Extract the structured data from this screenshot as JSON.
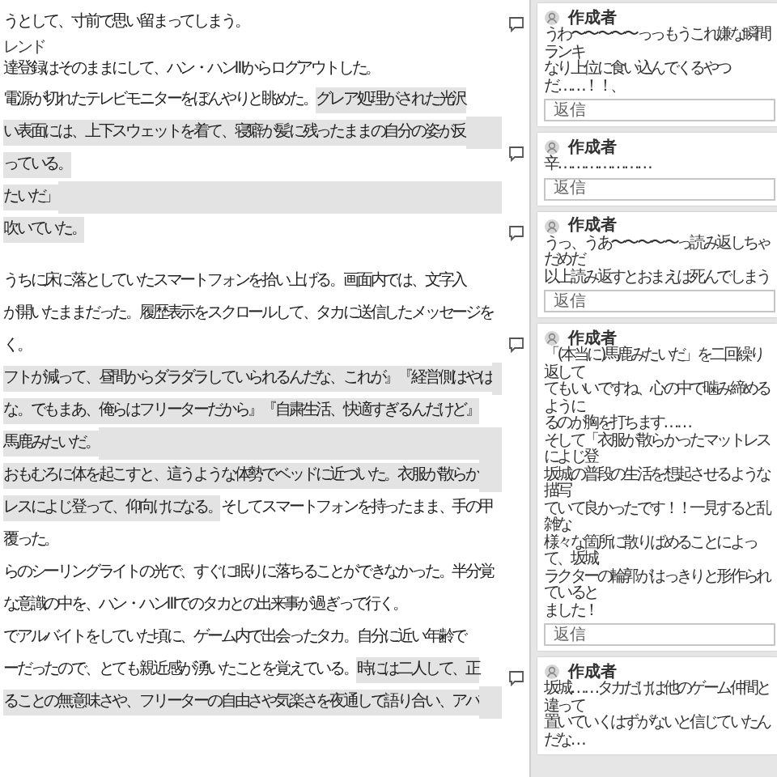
{
  "document": {
    "lines": [
      {
        "kind": "text",
        "highlight_to_end": false,
        "segments": [
          {
            "text": "うとして、寸前で思い留まってしまう。",
            "highlighted": false
          }
        ]
      },
      {
        "kind": "text",
        "highlight_to_end": false,
        "ruby": "レンド",
        "segments": [
          {
            "text": "達登録はそのままにして、ハン・ハンⅢからログアウトした。",
            "highlighted": false
          }
        ]
      },
      {
        "kind": "text",
        "highlight_to_end": false,
        "segments": [
          {
            "text": "電源が切れたテレビモニターをぼんやりと眺めた。",
            "highlighted": false
          },
          {
            "text": "グレア処理がされた光沢",
            "highlighted": true
          }
        ]
      },
      {
        "kind": "text",
        "highlight_to_end": true,
        "segments": [
          {
            "text": "い表面には、上下スウェットを着て、寝癖が髪に残ったままの自分の姿が反",
            "highlighted": true
          }
        ]
      },
      {
        "kind": "text",
        "highlight_to_end": false,
        "segments": [
          {
            "text": "っている。",
            "highlighted": true
          }
        ]
      },
      {
        "kind": "text",
        "highlight_to_end": true,
        "segments": [
          {
            "text": "たいだ」",
            "highlighted": true
          }
        ]
      },
      {
        "kind": "text",
        "highlight_to_end": false,
        "segments": [
          {
            "text": "吹いていた。",
            "highlighted": true
          }
        ]
      },
      {
        "kind": "blank"
      },
      {
        "kind": "text",
        "highlight_to_end": false,
        "segments": [
          {
            "text": "うちに床に落としていたスマートフォンを拾い上げる。画面内では、文字入",
            "highlighted": false
          }
        ]
      },
      {
        "kind": "text",
        "highlight_to_end": false,
        "segments": [
          {
            "text": "が開いたままだった。履歴表示をスクロールして、タカに送信したメッセージを",
            "highlighted": false
          }
        ]
      },
      {
        "kind": "text",
        "highlight_to_end": false,
        "segments": [
          {
            "text": "く。",
            "highlighted": false
          }
        ]
      },
      {
        "kind": "text",
        "highlight_to_end": true,
        "segments": [
          {
            "text": "フトが減って、昼間からダラダラしていられるんだな、これが』『経営側はやば",
            "highlighted": true
          }
        ]
      },
      {
        "kind": "text",
        "highlight_to_end": false,
        "segments": [
          {
            "text": "な。でもまあ、俺らはフリーターだから』『自粛生活、快適すぎるんだけど』",
            "highlighted": true
          }
        ]
      },
      {
        "kind": "text",
        "highlight_to_end": true,
        "segments": [
          {
            "text": "馬鹿みたいだ。",
            "highlighted": true
          }
        ]
      },
      {
        "kind": "text",
        "highlight_to_end": true,
        "segments": [
          {
            "text": "おもむろに体を起こすと、這うような体勢でベッドに近づいた。衣服が散らか",
            "highlighted": true
          }
        ]
      },
      {
        "kind": "text",
        "highlight_to_end": false,
        "segments": [
          {
            "text": "レスによじ登って、仰向けになる。",
            "highlighted": true
          },
          {
            "text": "そしてスマートフォンを持ったまま、手の甲",
            "highlighted": false
          }
        ]
      },
      {
        "kind": "text",
        "highlight_to_end": false,
        "segments": [
          {
            "text": "覆った。",
            "highlighted": false
          }
        ]
      },
      {
        "kind": "text",
        "highlight_to_end": false,
        "segments": [
          {
            "text": "らのシーリングライトの光で、すぐに眠りに落ちることができなかった。半分覚",
            "highlighted": false
          }
        ]
      },
      {
        "kind": "text",
        "highlight_to_end": false,
        "segments": [
          {
            "text": "な意識の中を、ハン・ハンⅢでのタカとの出来事が過ぎって行く。",
            "highlighted": false
          }
        ]
      },
      {
        "kind": "text",
        "highlight_to_end": false,
        "segments": [
          {
            "text": "でアルバイトをしていた頃に、ゲーム内で出会ったタカ。自分に近い年齢で",
            "highlighted": false
          }
        ]
      },
      {
        "kind": "text",
        "highlight_to_end": false,
        "segments": [
          {
            "text": "ーだったので、とても親近感が湧いたことを覚えている。",
            "highlighted": false
          },
          {
            "text": "時には二人して、正",
            "highlighted": true
          }
        ]
      },
      {
        "kind": "text",
        "highlight_to_end": true,
        "segments": [
          {
            "text": "ることの無意味さや、フリーターの自由さや気楽さを夜通しで語り合い、アバ",
            "highlighted": true
          }
        ]
      }
    ]
  },
  "comments": [
    {
      "author": "作成者",
      "lines": [
        "うわ〜〜〜〜〜っっもうこれ嫌な瞬間ランキ",
        "なり上位に食い込んでくるやつだ……！！、"
      ],
      "reply": {
        "placeholder": "返信"
      }
    },
    {
      "author": "作成者",
      "lines": [
        "辛…………………"
      ],
      "reply": {
        "placeholder": "返信"
      }
    },
    {
      "author": "作成者",
      "lines": [
        "うっ、うあ〜〜〜〜〜っ読み返しちゃだめだ",
        "以上読み返すとおまえは死んでしまう"
      ],
      "reply": {
        "placeholder": "返信"
      }
    },
    {
      "author": "作成者",
      "lines": [
        "「(本当に)馬鹿みたいだ」を二回繰り返して",
        "てもいいですね、心の中で噛み締めるように",
        "るのが胸を打ちます……",
        "そして「衣服が散らかったマットレスによじ登",
        "坂城の普段の生活を想起させるような描写",
        "ていて良かったです！！一見すると乱雑な",
        "様々な箇所に散りばめることによって、坂城",
        "ラクターの輪郭がはっきりと形作られていると",
        "ました！"
      ],
      "reply": {
        "placeholder": "返信"
      }
    },
    {
      "author": "作成者",
      "lines": [
        "坂城……タカだけは他のゲーム仲間と違って",
        "置いていくはずがないと信じていたんだな…"
      ]
    }
  ]
}
